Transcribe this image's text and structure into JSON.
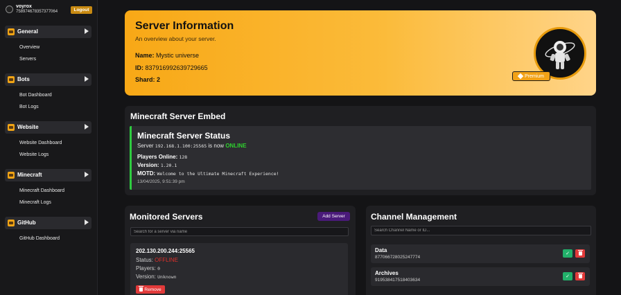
{
  "user": {
    "name": "voyrox",
    "id": "758974678357377064",
    "logout_label": "Logout"
  },
  "sidebar": {
    "sections": [
      {
        "label": "General",
        "items": [
          "Overview",
          "Servers"
        ]
      },
      {
        "label": "Bots",
        "items": [
          "Bot Dashboard",
          "Bot Logs"
        ]
      },
      {
        "label": "Website",
        "items": [
          "Website Dashboard",
          "Website Logs"
        ]
      },
      {
        "label": "Minecraft",
        "items": [
          "Minecraft Dashboard",
          "Minecraft Logs"
        ]
      },
      {
        "label": "GitHub",
        "items": [
          "GitHub Dashboard"
        ]
      }
    ]
  },
  "server_info": {
    "title": "Server Information",
    "subtitle": "An overview about your server.",
    "name_label": "Name:",
    "name_value": "Mystic universe",
    "id_label": "ID:",
    "id_value": "837916992639729665",
    "shard_label": "Shard:",
    "shard_value": "2",
    "premium_label": "Premium"
  },
  "embed": {
    "title": "Minecraft Server Embed",
    "status_title": "Minecraft Server Status",
    "server_prefix": "Server",
    "server_address": "192.168.1.100:25565",
    "server_mid": "is now",
    "server_status": "ONLINE",
    "players_label": "Players Online:",
    "players_value": "128",
    "version_label": "Version:",
    "version_value": "1.20.1",
    "motd_label": "MOTD:",
    "motd_value": "Welcome to the Ultimate Minecraft Experience!",
    "timestamp": "13/04/2025, 9:51:39 pm"
  },
  "monitored": {
    "title": "Monitored Servers",
    "add_label": "Add Server",
    "search_placeholder": "Search for a server via name",
    "server": {
      "address": "202.130.200.244:25565",
      "status_label": "Status:",
      "status_value": "OFFLINE",
      "players_label": "Players:",
      "players_value": "0",
      "version_label": "Version:",
      "version_value": "Unknown",
      "remove_label": "Remove"
    }
  },
  "channels": {
    "title": "Channel Management",
    "search_placeholder": "Search Channel Name or ID...",
    "items": [
      {
        "name": "Data",
        "id": "877066728025247774"
      },
      {
        "name": "Archives",
        "id": "919538417518403634"
      }
    ]
  },
  "colors": {
    "accent": "#f8a816",
    "online": "#2ed12e",
    "offline": "#e0302b",
    "add_button": "#4a1a7a"
  }
}
